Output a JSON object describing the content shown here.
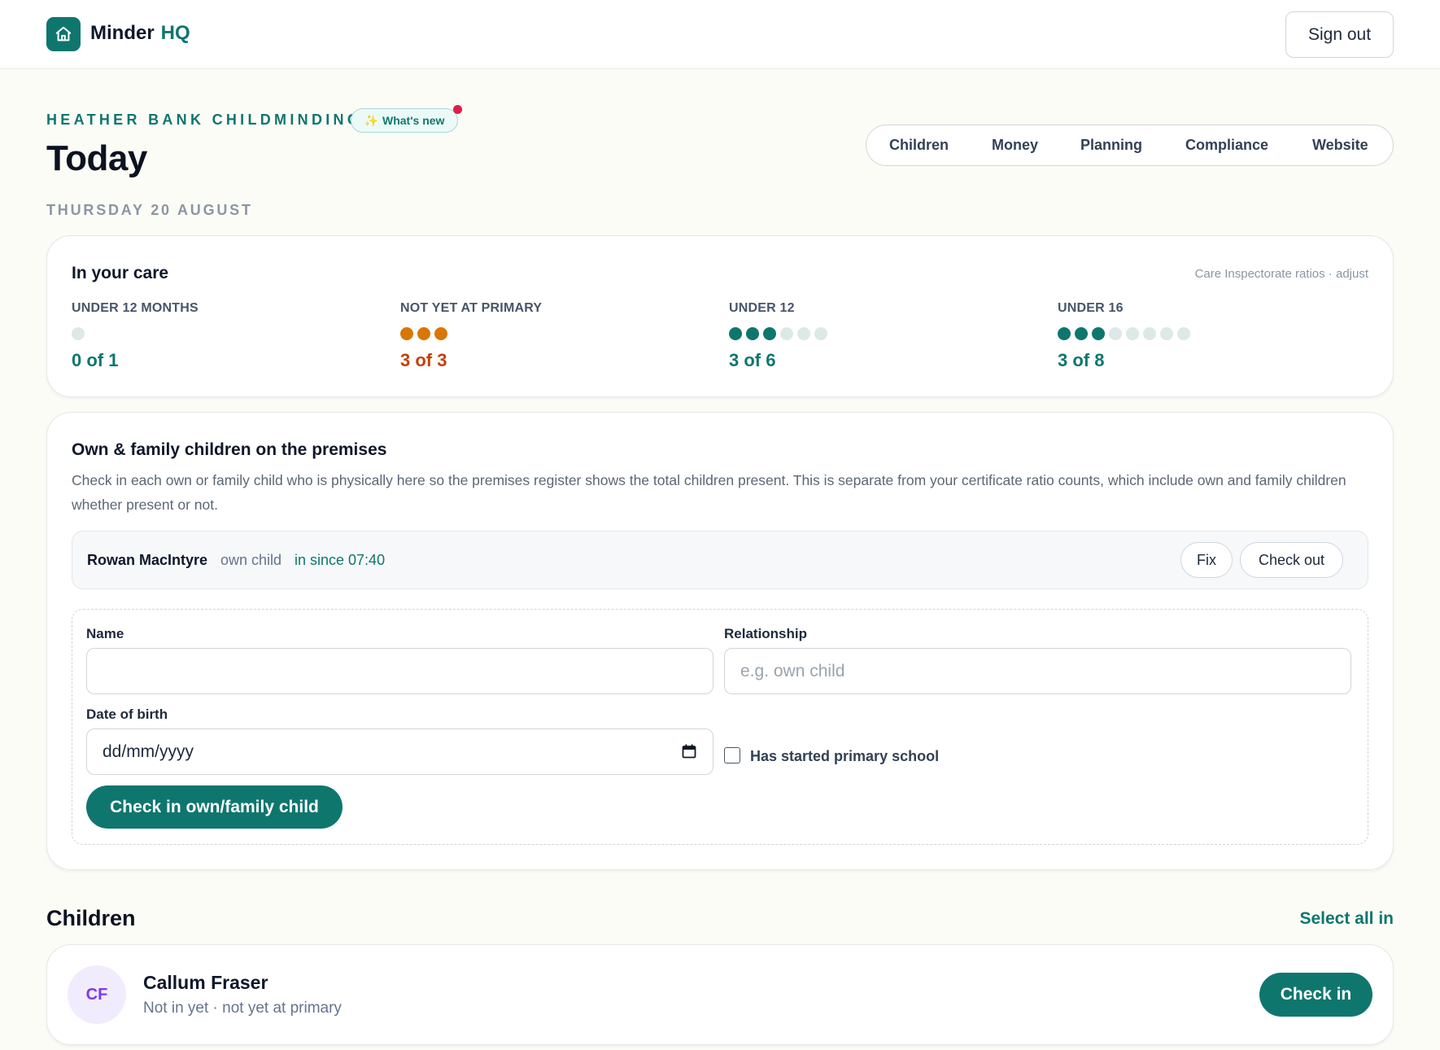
{
  "app": {
    "brand": "Minder",
    "brand_accent": "HQ",
    "sign_out": "Sign out",
    "logo_icon": "home-icon",
    "accent_color": "#0f766e"
  },
  "header": {
    "org_name": "HEATHER BANK CHILDMINDING",
    "whats_new": "What's new",
    "whats_new_icon": "sparkles-icon",
    "page_title": "Today",
    "date": "THURSDAY 20 AUGUST",
    "nav": [
      "Children",
      "Money",
      "Planning",
      "Compliance",
      "Website"
    ]
  },
  "care": {
    "title": "In your care",
    "ratio_link": "Care Inspectorate ratios · adjust",
    "groups": [
      {
        "label": "UNDER 12 MONTHS",
        "count": 0,
        "capacity": 1,
        "value_text": "0 of 1",
        "at_limit": false
      },
      {
        "label": "NOT YET AT PRIMARY",
        "count": 3,
        "capacity": 3,
        "value_text": "3 of 3",
        "at_limit": true
      },
      {
        "label": "UNDER 12",
        "count": 3,
        "capacity": 6,
        "value_text": "3 of 6",
        "at_limit": false
      },
      {
        "label": "UNDER 16",
        "count": 3,
        "capacity": 8,
        "value_text": "3 of 8",
        "at_limit": false
      }
    ]
  },
  "premises": {
    "title": "Own & family children on the premises",
    "description": "Check in each own or family child who is physically here so the premises register shows the total children present. This is separate from your certificate ratio counts, which include own and family children whether present or not.",
    "present": {
      "name": "Rowan MacIntyre",
      "relationship": "own child",
      "since": "in since 07:40",
      "fix_label": "Fix",
      "checkout_label": "Check out"
    },
    "form": {
      "name_label": "Name",
      "name_value": "",
      "relationship_label": "Relationship",
      "relationship_placeholder": "e.g. own child",
      "dob_label": "Date of birth",
      "dob_placeholder": "dd/mm/yyyy",
      "calendar_icon": "calendar-icon",
      "primary_label": "Has started primary school",
      "primary_checked": false,
      "submit_label": "Check in own/family child"
    }
  },
  "children": {
    "title": "Children",
    "select_all": "Select all in",
    "items": [
      {
        "initials": "CF",
        "name": "Callum Fraser",
        "status": "Not in yet · not yet at primary",
        "action": "Check in"
      }
    ]
  }
}
